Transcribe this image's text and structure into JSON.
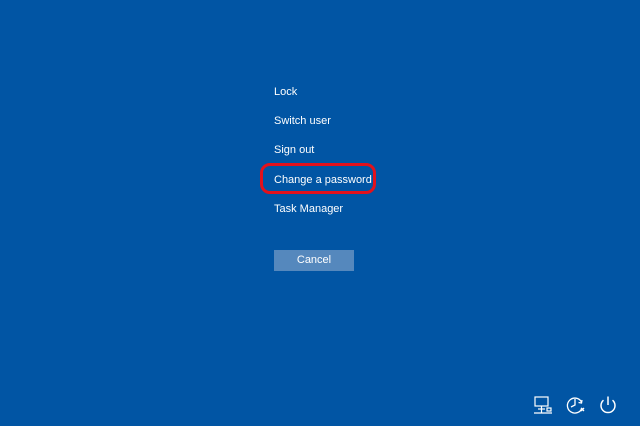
{
  "menu": {
    "items": [
      {
        "label": "Lock"
      },
      {
        "label": "Switch user"
      },
      {
        "label": "Sign out"
      },
      {
        "label": "Change a password"
      },
      {
        "label": "Task Manager"
      }
    ]
  },
  "cancel_label": "Cancel",
  "system_icons": [
    "network-icon",
    "ease-of-access-icon",
    "power-icon"
  ],
  "colors": {
    "background": "#0155a4",
    "button": "#5588bd",
    "highlight": "#e3111b",
    "text": "#ffffff"
  }
}
